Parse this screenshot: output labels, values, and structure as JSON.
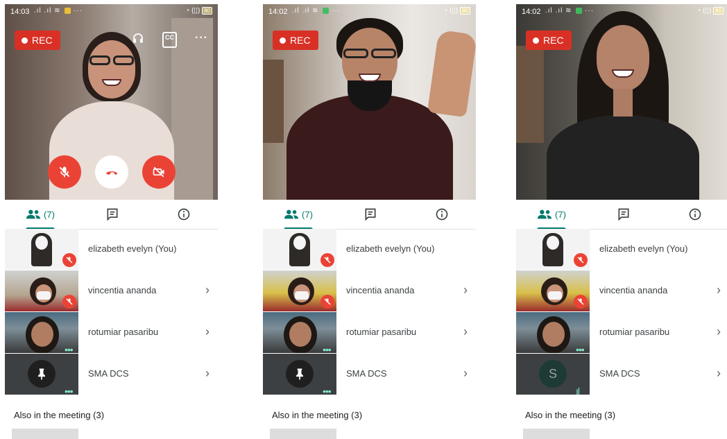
{
  "phones": [
    {
      "status": {
        "time": "14:03",
        "battery": "80"
      },
      "rec_label": "REC",
      "show_top_icons": true,
      "show_controls": true,
      "tabs": {
        "people_count": "(7)"
      },
      "participants": [
        {
          "name": "elizabeth evelyn (You)",
          "muted": true,
          "chevron": false
        },
        {
          "name": "vincentia ananda",
          "muted": true,
          "chevron": true
        },
        {
          "name": "rotumiar pasaribu",
          "muted": false,
          "chevron": true
        },
        {
          "name": "SMA DCS",
          "muted": false,
          "chevron": true
        }
      ],
      "also_label": "Also in the meeting (3)"
    },
    {
      "status": {
        "time": "14:02",
        "battery": "80"
      },
      "rec_label": "REC",
      "show_top_icons": false,
      "show_controls": false,
      "tabs": {
        "people_count": "(7)"
      },
      "participants": [
        {
          "name": "elizabeth evelyn (You)",
          "muted": true,
          "chevron": false
        },
        {
          "name": "vincentia ananda",
          "muted": true,
          "chevron": true
        },
        {
          "name": "rotumiar pasaribu",
          "muted": false,
          "chevron": true
        },
        {
          "name": "SMA DCS",
          "muted": false,
          "chevron": true
        }
      ],
      "also_label": "Also in the meeting (3)"
    },
    {
      "status": {
        "time": "14:02",
        "battery": "80"
      },
      "rec_label": "REC",
      "show_top_icons": false,
      "show_controls": false,
      "tabs": {
        "people_count": "(7)"
      },
      "participants": [
        {
          "name": "elizabeth evelyn (You)",
          "muted": true,
          "chevron": false
        },
        {
          "name": "vincentia ananda",
          "muted": true,
          "chevron": true
        },
        {
          "name": "rotumiar pasaribu",
          "muted": false,
          "chevron": true
        },
        {
          "name": "SMA DCS",
          "muted": false,
          "chevron": true,
          "avatar_letter": "S"
        }
      ],
      "also_label": "Also in the meeting (3)"
    }
  ],
  "colors": {
    "accent": "#00796b",
    "rec": "#d93025",
    "end_call": "#ea4335"
  },
  "icons": [
    "headphones-icon",
    "closed-caption-icon",
    "more-options-icon",
    "mic-off-icon",
    "end-call-icon",
    "camera-off-icon",
    "people-icon",
    "chat-icon",
    "info-icon",
    "chevron-right-icon",
    "pin-icon"
  ]
}
